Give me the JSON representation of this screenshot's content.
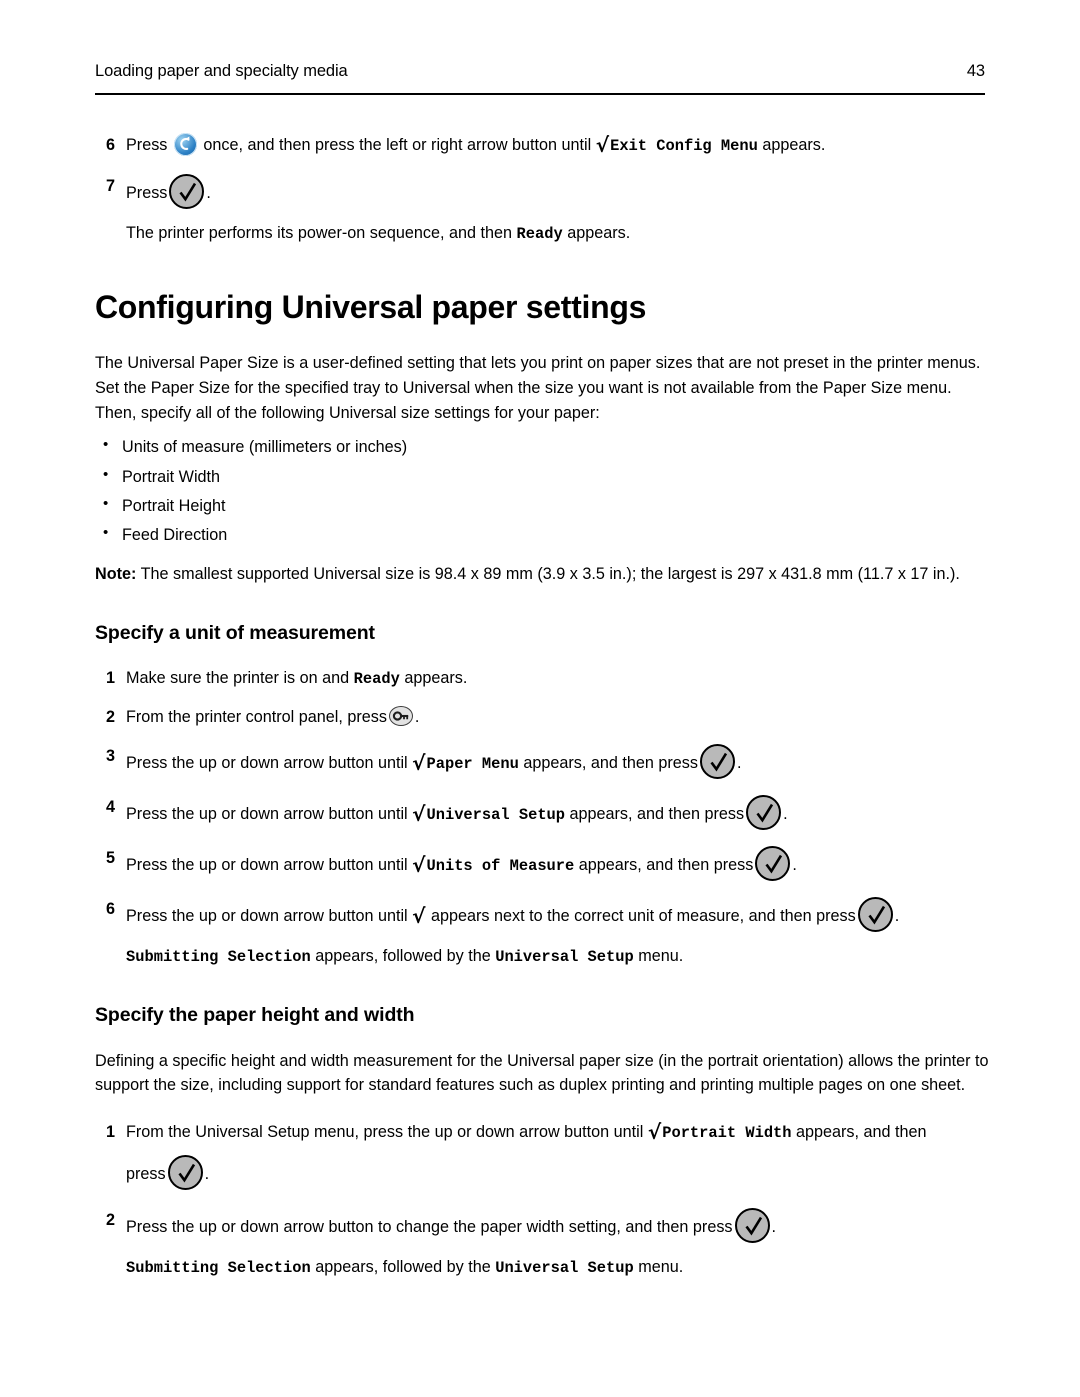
{
  "header": {
    "title": "Loading paper and specialty media",
    "page_number": "43"
  },
  "icons": {
    "back_button": "back-arrow-button-icon",
    "select_button": "select-checkmark-button-icon",
    "menu_button": "menu-key-button-icon",
    "checkmark_glyph": "√"
  },
  "top_steps": [
    {
      "number": "6",
      "text_before_icon": "Press",
      "text_after_icon": "once, and then press the left or right arrow button until",
      "display_text": "Exit Config Menu",
      "text_tail": "appears.",
      "icon": "back-arrow-button-icon"
    },
    {
      "number": "7",
      "text_before_icon": "Press",
      "text_after_icon": ".",
      "icon": "select-checkmark-button-icon",
      "sub_before": "The printer performs its power-on sequence, and then",
      "sub_display": "Ready",
      "sub_after": "appears."
    }
  ],
  "chapter_heading": "Configuring Universal paper settings",
  "intro_paragraph": "The Universal Paper Size is a user‑defined setting that lets you print on paper sizes that are not preset in the printer menus. Set the Paper Size for the specified tray to Universal when the size you want is not available from the Paper Size menu. Then, specify all of the following Universal size settings for your paper:",
  "bullets": [
    "Units of measure (millimeters or inches)",
    "Portrait Width",
    "Portrait Height",
    "Feed Direction"
  ],
  "note": {
    "label": "Note:",
    "text": "The smallest supported Universal size is 98.4 x 89 mm (3.9 x 3.5 in.); the largest is 297 x 431.8 mm (11.7 x 17 in.)."
  },
  "section_unit": {
    "heading": "Specify a unit of measurement",
    "steps": [
      {
        "number": "1",
        "prefix": "Make sure the printer is on and",
        "display_text": "Ready",
        "suffix": "appears."
      },
      {
        "number": "2",
        "prefix": "From the printer control panel, press",
        "icon": "menu-key-button-icon",
        "suffix": "."
      },
      {
        "number": "3",
        "prefix": "Press the up or down arrow button until",
        "display_text": "Paper Menu",
        "middle": "appears, and then press",
        "icon": "select-checkmark-button-icon",
        "suffix": "."
      },
      {
        "number": "4",
        "prefix": "Press the up or down arrow button until",
        "display_text": "Universal Setup",
        "middle": "appears, and then press",
        "icon": "select-checkmark-button-icon",
        "suffix": "."
      },
      {
        "number": "5",
        "prefix": "Press the up or down arrow button until",
        "display_text": "Units of Measure",
        "middle": "appears, and then press",
        "icon": "select-checkmark-button-icon",
        "suffix": "."
      },
      {
        "number": "6",
        "prefix": "Press the up or down arrow button until",
        "display_text": "",
        "middle": "appears next to the correct unit of measure, and then press",
        "icon": "select-checkmark-button-icon",
        "suffix": ".",
        "sub_display_1": "Submitting Selection",
        "sub_middle": "appears, followed by the",
        "sub_display_2": "Universal Setup",
        "sub_tail": "menu."
      }
    ]
  },
  "section_size": {
    "heading": "Specify the paper height and width",
    "paragraph": "Defining a specific height and width measurement for the Universal paper size (in the portrait orientation) allows the printer to support the size, including support for standard features such as duplex printing and printing multiple pages on one sheet.",
    "steps": [
      {
        "number": "1",
        "prefix": "From the Universal Setup menu, press the up or down arrow button until",
        "display_text": "Portrait Width",
        "middle": "appears, and then",
        "second_line_prefix": "press",
        "icon": "select-checkmark-button-icon",
        "suffix": "."
      },
      {
        "number": "2",
        "prefix": "Press the up or down arrow button to change the paper width setting, and then press",
        "icon": "select-checkmark-button-icon",
        "suffix": ".",
        "sub_display_1": "Submitting Selection",
        "sub_middle": "appears, followed by the",
        "sub_display_2": "Universal Setup",
        "sub_tail": "menu."
      }
    ]
  }
}
